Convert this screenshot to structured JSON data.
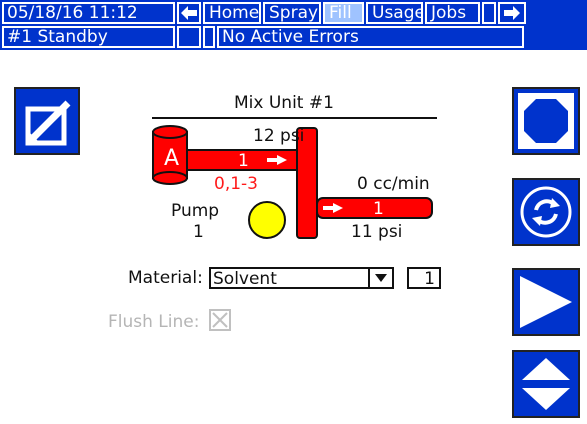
{
  "header": {
    "datetime": "05/18/16 11:12",
    "tabs": [
      {
        "label": "Home",
        "active": false
      },
      {
        "label": "Spray",
        "active": false
      },
      {
        "label": "Fill",
        "active": true
      },
      {
        "label": "Usage",
        "active": false
      },
      {
        "label": "Jobs",
        "active": false
      }
    ],
    "status": "#1 Standby",
    "errors": "No Active Errors"
  },
  "diagram": {
    "title": "Mix Unit #1",
    "tank_label": "A",
    "inlet_pressure": "12 psi",
    "inlet_value": "1",
    "inlet_range": "0,1-3",
    "pump_label": "Pump",
    "pump_number": "1",
    "flow_rate": "0 cc/min",
    "outlet_value": "1",
    "outlet_pressure": "11 psi"
  },
  "form": {
    "material_label": "Material:",
    "material_value": "Solvent",
    "material_number": "1",
    "flush_label": "Flush Line:",
    "flush_checked": false
  },
  "colors": {
    "bar": "#0033cc",
    "pipe": "#ff0000",
    "pump": "#ffff00",
    "range_text": "#ff1a1a",
    "active_tab": "#9fc3ff"
  },
  "icons": {
    "back": "arrow-left-icon",
    "forward": "arrow-right-icon",
    "edit": "edit-checkbox-icon",
    "stop": "stop-octagon-icon",
    "refresh": "refresh-cycle-icon",
    "play": "play-icon",
    "updown": "up-down-icon"
  }
}
